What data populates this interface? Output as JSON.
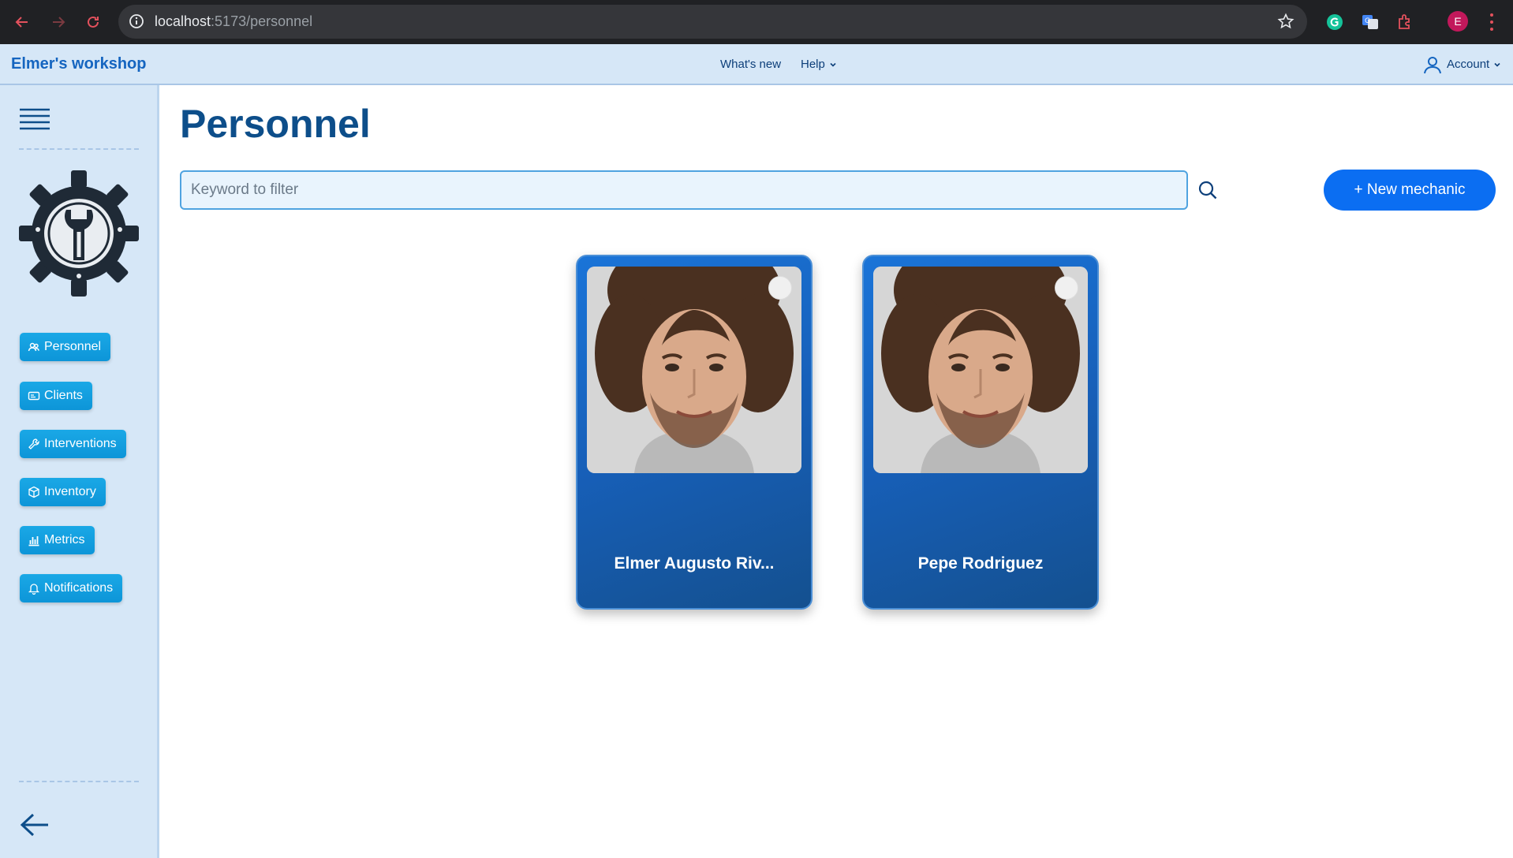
{
  "browser": {
    "url_host": "localhost",
    "url_path": ":5173/personnel",
    "profile_initial": "E"
  },
  "header": {
    "app_title": "Elmer's workshop",
    "whats_new": "What's new",
    "help": "Help",
    "account": "Account"
  },
  "sidebar": {
    "items": [
      {
        "label": "Personnel",
        "icon": "users-icon"
      },
      {
        "label": "Clients",
        "icon": "id-card-icon"
      },
      {
        "label": "Interventions",
        "icon": "wrench-icon"
      },
      {
        "label": "Inventory",
        "icon": "box-icon"
      },
      {
        "label": "Metrics",
        "icon": "bar-chart-icon"
      },
      {
        "label": "Notifications",
        "icon": "bell-icon"
      }
    ]
  },
  "main": {
    "title": "Personnel",
    "search_placeholder": "Keyword to filter",
    "new_button": "+ New mechanic",
    "cards": [
      {
        "name": "Elmer Augusto Riv..."
      },
      {
        "name": "Pepe Rodriguez"
      }
    ]
  },
  "colors": {
    "accent": "#0b6ef2",
    "sidebar_bg": "#d6e7f7",
    "card_blue": "#175fb8",
    "title_blue": "#0d4e8a"
  }
}
